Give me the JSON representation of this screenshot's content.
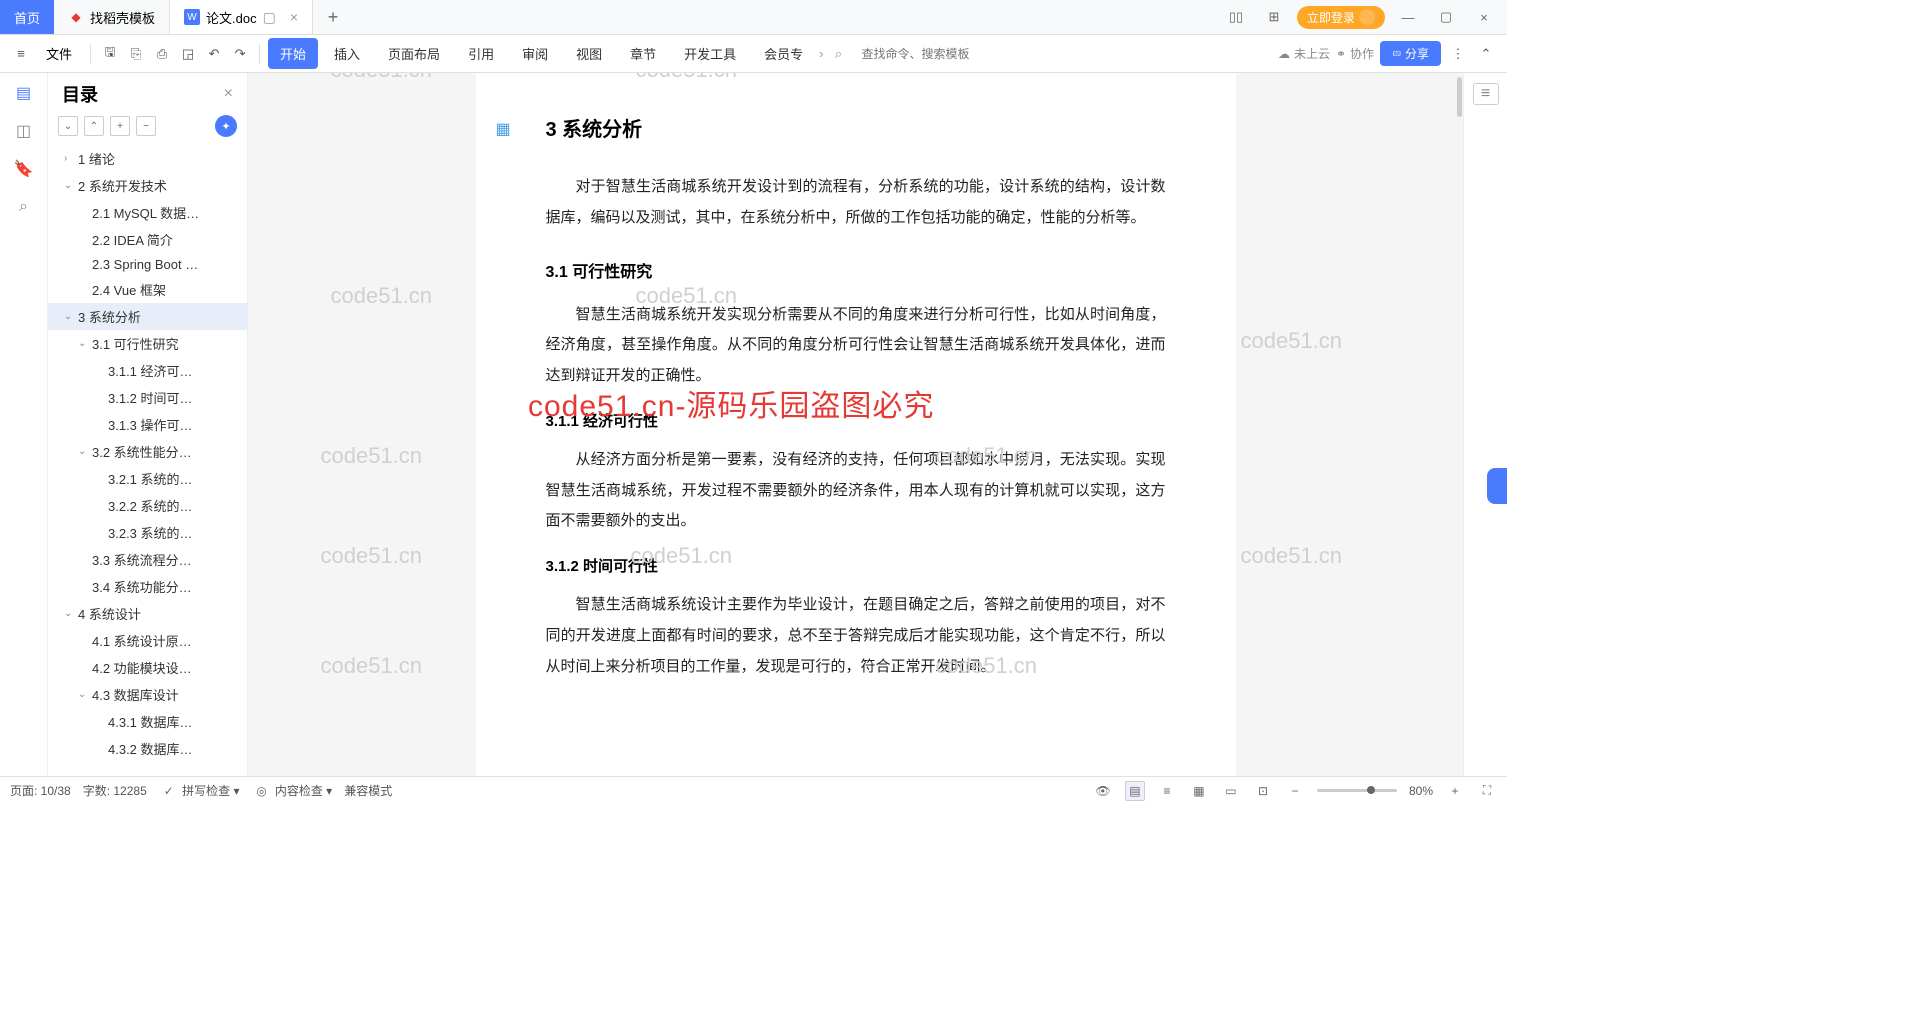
{
  "tabs": {
    "home": "首页",
    "t1": "找稻壳模板",
    "t2": "论文.doc",
    "login": "立即登录"
  },
  "ribbon": {
    "file": "文件",
    "menus": [
      "开始",
      "插入",
      "页面布局",
      "引用",
      "审阅",
      "视图",
      "章节",
      "开发工具",
      "会员专"
    ],
    "search_placeholder": "查找命令、搜索模板",
    "cloud": "未上云",
    "collab": "协作",
    "share": "分享"
  },
  "outline": {
    "title": "目录",
    "items": [
      {
        "lvl": 1,
        "chev": "›",
        "txt": "1  绪论"
      },
      {
        "lvl": 1,
        "chev": "⌄",
        "txt": "2  系统开发技术"
      },
      {
        "lvl": 2,
        "chev": "",
        "txt": "2.1 MySQL 数据…"
      },
      {
        "lvl": 2,
        "chev": "",
        "txt": "2.2 IDEA 简介"
      },
      {
        "lvl": 2,
        "chev": "",
        "txt": "2.3 Spring Boot …"
      },
      {
        "lvl": 2,
        "chev": "",
        "txt": "2.4 Vue 框架"
      },
      {
        "lvl": 1,
        "chev": "⌄",
        "txt": "3  系统分析",
        "sel": true
      },
      {
        "lvl": 2,
        "chev": "⌄",
        "txt": "3.1  可行性研究"
      },
      {
        "lvl": 3,
        "chev": "",
        "txt": "3.1.1  经济可…"
      },
      {
        "lvl": 3,
        "chev": "",
        "txt": "3.1.2  时间可…"
      },
      {
        "lvl": 3,
        "chev": "",
        "txt": "3.1.3  操作可…"
      },
      {
        "lvl": 2,
        "chev": "⌄",
        "txt": "3.2  系统性能分…"
      },
      {
        "lvl": 3,
        "chev": "",
        "txt": "3.2.1  系统的…"
      },
      {
        "lvl": 3,
        "chev": "",
        "txt": "3.2.2  系统的…"
      },
      {
        "lvl": 3,
        "chev": "",
        "txt": "3.2.3  系统的…"
      },
      {
        "lvl": 2,
        "chev": "",
        "txt": "3.3  系统流程分…"
      },
      {
        "lvl": 2,
        "chev": "",
        "txt": "3.4  系统功能分…"
      },
      {
        "lvl": 1,
        "chev": "⌄",
        "txt": "4  系统设计"
      },
      {
        "lvl": 2,
        "chev": "",
        "txt": "4.1  系统设计原…"
      },
      {
        "lvl": 2,
        "chev": "",
        "txt": "4.2  功能模块设…"
      },
      {
        "lvl": 2,
        "chev": "⌄",
        "txt": "4.3  数据库设计"
      },
      {
        "lvl": 3,
        "chev": "",
        "txt": "4.3.1  数据库…"
      },
      {
        "lvl": 3,
        "chev": "",
        "txt": "4.3.2  数据库…"
      }
    ]
  },
  "doc": {
    "h1": "3  系统分析",
    "p1": "对于智慧生活商城系统开发设计到的流程有，分析系统的功能，设计系统的结构，设计数据库，编码以及测试，其中，在系统分析中，所做的工作包括功能的确定，性能的分析等。",
    "h2a": "3.1  可行性研究",
    "p2": "智慧生活商城系统开发实现分析需要从不同的角度来进行分析可行性，比如从时间角度，经济角度，甚至操作角度。从不同的角度分析可行性会让智慧生活商城系统开发具体化，进而达到辩证开发的正确性。",
    "h3a": "3.1.1  经济可行性",
    "p3": "从经济方面分析是第一要素，没有经济的支持，任何项目都如水中捞月，无法实现。实现智慧生活商城系统，开发过程不需要额外的经济条件，用本人现有的计算机就可以实现，这方面不需要额外的支出。",
    "h3b": "3.1.2  时间可行性",
    "p4": "智慧生活商城系统设计主要作为毕业设计，在题目确定之后，答辩之前使用的项目，对不同的开发进度上面都有时间的要求，总不至于答辩完成后才能实现功能，这个肯定不行，所以从时间上来分析项目的工作量，发现是可行的，符合正常开发时间。"
  },
  "watermarks": {
    "wm": "code51.cn",
    "red": "code51.cn-源码乐园盗图必究"
  },
  "status": {
    "page": "页面: 10/38",
    "words": "字数: 12285",
    "spell": "拼写检查",
    "content": "内容检查",
    "compat": "兼容模式",
    "zoom": "80%"
  }
}
